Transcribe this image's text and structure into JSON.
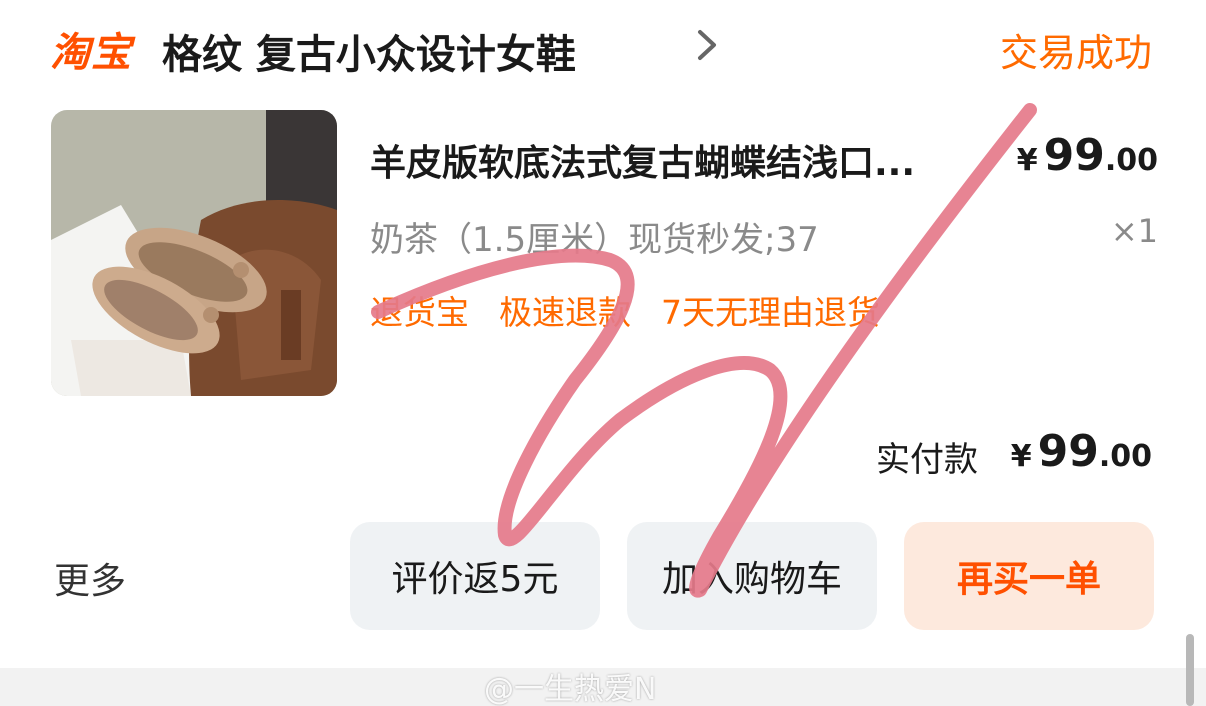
{
  "header": {
    "brand": "淘宝",
    "shop_name": "格纹 复古小众设计女鞋",
    "status": "交易成功"
  },
  "product": {
    "title": "羊皮版软底法式复古蝴蝶结浅口...",
    "price_currency": "¥",
    "price_int": "99",
    "price_dec": ".00",
    "sku": "奶茶（1.5厘米）现货秒发;37",
    "quantity": "×1",
    "tags": [
      "退货宝",
      "极速退款",
      "7天无理由退货"
    ]
  },
  "summary": {
    "label": "实付款",
    "currency": "¥",
    "amount_int": "99",
    "amount_dec": ".00"
  },
  "actions": {
    "more": "更多",
    "review": "评价返5元",
    "add_to_cart": "加入购物车",
    "rebuy": "再买一单"
  },
  "watermark": "@一生热爱N",
  "colors": {
    "accent": "#ff5000",
    "status": "#ff6a00",
    "scribble": "#e57a8a"
  }
}
